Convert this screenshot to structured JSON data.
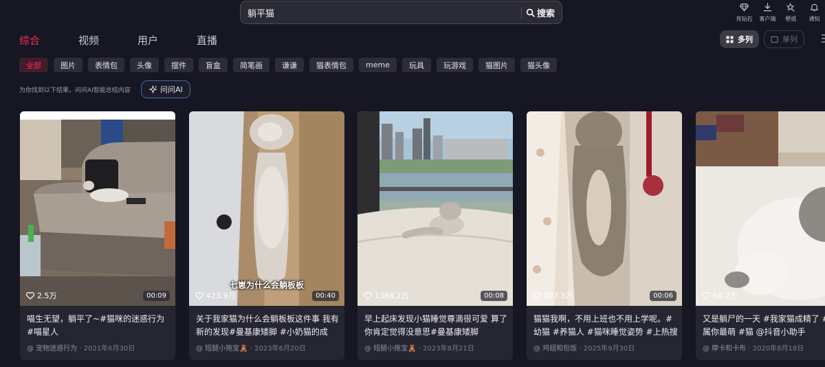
{
  "search": {
    "query": "躺平猫",
    "button_label": "搜索"
  },
  "top_actions": [
    {
      "label": "充钻石",
      "icon": "diamond-icon"
    },
    {
      "label": "客户端",
      "icon": "download-icon"
    },
    {
      "label": "壁纸",
      "icon": "wallpaper-icon"
    },
    {
      "label": "通知",
      "icon": "bell-icon"
    }
  ],
  "tabs": [
    "综合",
    "视频",
    "用户",
    "直播"
  ],
  "view_toggle": {
    "multi": "多列",
    "single": "单列"
  },
  "filters": [
    "全部",
    "图片",
    "表情包",
    "头像",
    "摆件",
    "盲盒",
    "简笔画",
    "谦谦",
    "猫表情包",
    "meme",
    "玩具",
    "玩游戏",
    "猫图片",
    "猫头像"
  ],
  "hint": "为你找到以下结果，问问AI智能总结内容",
  "ask_ai_label": "问问AI",
  "colors": {
    "accent": "#fe2c55",
    "background": "#161722",
    "card": "#252632"
  },
  "cards": [
    {
      "likes": "2.5万",
      "duration": "00:09",
      "title": "喵生无望，躺平了~#猫咪的迷惑行为 #喵星人",
      "author": "@ 宠物迷惑行为",
      "date": "· 2021年6月30日",
      "overlay": ""
    },
    {
      "likes": "423.9万",
      "duration": "00:40",
      "title": "关于我家猫为什么会躺板板这件事 我有新的发现#曼基康矮脚 #小奶猫的成长…",
      "author": "@ 短腿小拖宝🧸",
      "date": "· 2023年6月20日",
      "overlay": "七崽为什么会躺板板"
    },
    {
      "likes": "1368.2万",
      "duration": "00:08",
      "title": "早上起床发现小猫睡觉尊滴很可爱 算了你肯定觉得没意思#曼基康矮脚",
      "author": "@ 短腿小拖宝🧸",
      "date": "· 2023年8月21日",
      "overlay": ""
    },
    {
      "likes": "927.3万",
      "duration": "00:06",
      "title": "猫猫我啊，不用上班也不用上学呢。#幼猫 #养猫人 #猫咪睡觉姿势 #上热搜 …",
      "author": "@ 鸡翅和包饭",
      "date": "· 2025年9月30日",
      "overlay": ""
    },
    {
      "likes": "98.2万",
      "duration": "",
      "title": "又是躺尸的一天 #我家猫成精了 #好口属你最萌 #猫 @抖音小助手",
      "author": "@ 摩卡和卡布",
      "date": "· 2020年8月18日",
      "overlay": ""
    }
  ]
}
